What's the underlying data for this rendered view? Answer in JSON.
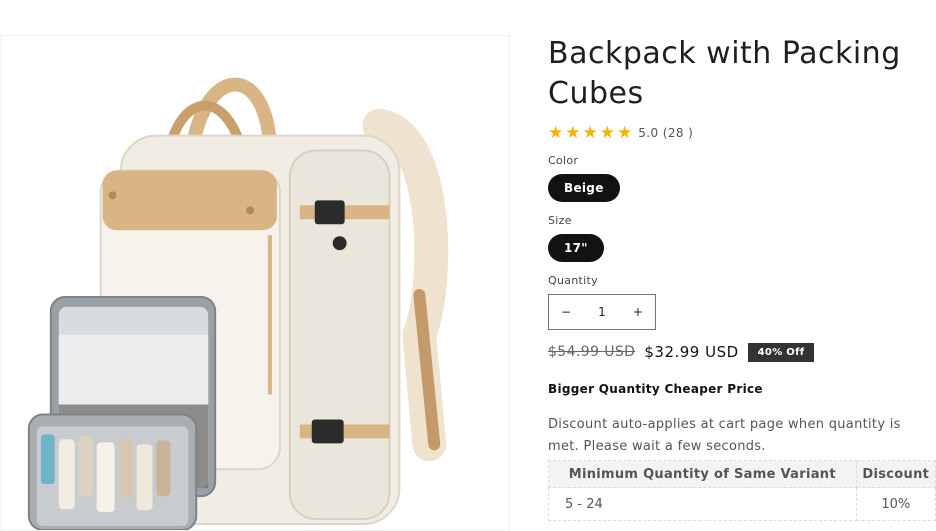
{
  "product": {
    "title": "Backpack with Packing Cubes",
    "rating": {
      "stars": 5,
      "text": "5.0 (28 )"
    },
    "color": {
      "label": "Color",
      "selected": "Beige"
    },
    "size": {
      "label": "Size",
      "selected": "17\""
    },
    "quantity": {
      "label": "Quantity",
      "value": "1",
      "minus": "−",
      "plus": "+"
    },
    "price": {
      "compare_at": "$54.99 USD",
      "sale": "$32.99 USD",
      "badge": "40% Off"
    },
    "bulk": {
      "heading": "Bigger Quantity Cheaper Price",
      "description": "Discount auto-applies at cart page when quantity is met. Please wait a few seconds.",
      "headers": [
        "Minimum Quantity of Same Variant",
        "Discount"
      ],
      "rows": [
        [
          "5 - 24",
          "10%"
        ]
      ]
    }
  },
  "colors": {
    "star": "#f4b400",
    "pill": "#121212",
    "badge": "#333333"
  }
}
